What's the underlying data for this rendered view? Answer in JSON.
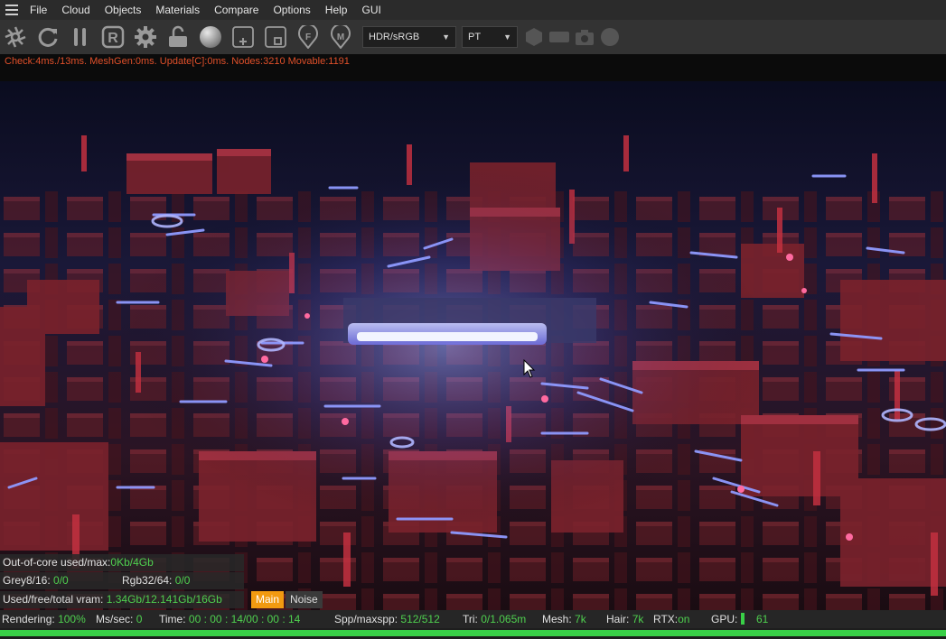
{
  "menu": [
    "File",
    "Cloud",
    "Objects",
    "Materials",
    "Compare",
    "Options",
    "Help",
    "GUI"
  ],
  "toolbar": {
    "icons": [
      "aperture-icon",
      "refresh-icon",
      "pause-icon",
      "r-icon",
      "gear-icon",
      "unlock-icon",
      "sphere-icon",
      "add-region-icon",
      "stop-region-icon",
      "focus-pin-icon",
      "material-pin-icon"
    ],
    "colorspace": "HDR/sRGB",
    "kernel": "PT",
    "extra_icons": [
      "hexagon-icon",
      "rect-icon",
      "camera-icon",
      "circle-icon"
    ]
  },
  "status_line": "Check:4ms./13ms. MeshGen:0ms. Update[C]:0ms. Nodes:3210 Movable:1191",
  "info": {
    "ooc_label": "Out-of-core used/max:",
    "ooc_value": "0Kb/4Gb",
    "grey_label": "Grey8/16:",
    "grey_value": "0/0",
    "rgb_label": "Rgb32/64:",
    "rgb_value": "0/0",
    "vram_label": "Used/free/total vram:",
    "vram_value": "1.34Gb/12.141Gb/16Gb"
  },
  "view_tabs": {
    "main": "Main",
    "noise": "Noise"
  },
  "bottom": {
    "rendering_label": "Rendering:",
    "rendering_value": "100%",
    "ms_label": "Ms/sec:",
    "ms_value": "0",
    "time_label": "Time:",
    "time_value": "00 : 00 : 14/00 : 00 : 14",
    "spp_label": "Spp/maxspp:",
    "spp_value": "512/512",
    "tri_label": "Tri:",
    "tri_value": "0/1.065m",
    "mesh_label": "Mesh:",
    "mesh_value": "7k",
    "hair_label": "Hair:",
    "hair_value": "7k",
    "rtx_label": "RTX:",
    "rtx_value": "on",
    "gpu_label": "GPU:",
    "gpu_value": "61"
  },
  "progress_fraction": 1.0,
  "colors": {
    "accent": "#f29a10",
    "value_green": "#4fd04f",
    "status_orange": "#e0502a",
    "progress": "#39d047"
  }
}
